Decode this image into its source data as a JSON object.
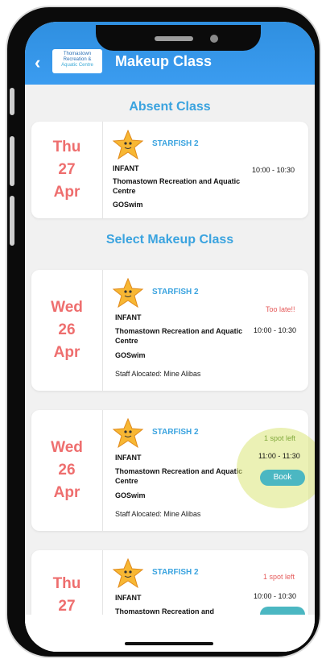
{
  "header": {
    "title": "Makeup Class",
    "logo_lines": [
      "Thomastown",
      "Recreation &",
      "Aquatic Centre"
    ]
  },
  "absent_section": {
    "title": "Absent Class"
  },
  "makeup_section": {
    "title": "Select Makeup Class"
  },
  "absent_class": {
    "day": "Thu",
    "date": "27",
    "month": "Apr",
    "class_name": "STARFISH 2",
    "level": "INFANT",
    "venue": "Thomastown Recreation and Aquatic Centre",
    "org": "GOSwim",
    "time": "10:00 - 10:30"
  },
  "makeup_classes": [
    {
      "day": "Wed",
      "date": "26",
      "month": "Apr",
      "class_name": "STARFISH 2",
      "level": "INFANT",
      "venue": "Thomastown Recreation and Aquatic Centre",
      "org": "GOSwim",
      "staff": "Staff Alocated: Mine Alibas",
      "status": "Too late!!",
      "time": "10:00 - 10:30"
    },
    {
      "day": "Wed",
      "date": "26",
      "month": "Apr",
      "class_name": "STARFISH 2",
      "level": "INFANT",
      "venue": "Thomastown Recreation and Aquatic Centre",
      "org": "GOSwim",
      "staff": "Staff Alocated: Mine Alibas",
      "status": "1 spot left",
      "time": "11:00 - 11:30",
      "button": "Book"
    },
    {
      "day": "Thu",
      "date": "27",
      "class_name": "STARFISH 2",
      "level": "INFANT",
      "venue": "Thomastown Recreation and",
      "status": "1 spot left",
      "time": "10:00 - 10:30"
    }
  ],
  "colors": {
    "header": "#3b9cf0",
    "accent": "#3aa3df",
    "date": "#ee6e6e",
    "book": "#4bb7c2",
    "status_red": "#e55b5b",
    "status_green": "#7fa83a"
  }
}
